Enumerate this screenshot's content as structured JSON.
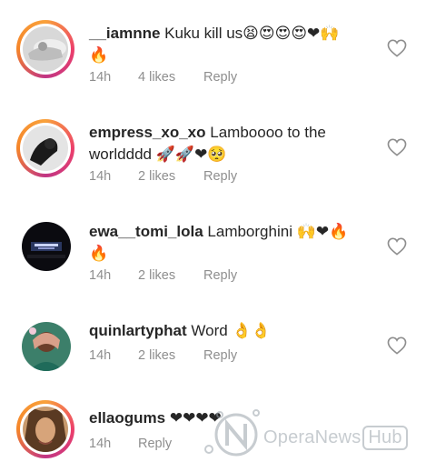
{
  "comments": [
    {
      "username": "__iamnne",
      "text": "Kuku kill us",
      "emojis_line1": "😫😍😍😍❤🙌",
      "emojis_line2": "🔥",
      "time": "14h",
      "likes": "4 likes",
      "reply": "Reply",
      "has_story_ring": true
    },
    {
      "username": "empress_xo_xo",
      "text_line1": "Lamboooo to the",
      "text_line2": "worldddd",
      "emojis": "🚀🚀❤🥺",
      "time": "14h",
      "likes": "2 likes",
      "reply": "Reply",
      "has_story_ring": true
    },
    {
      "username": "ewa__tomi_lola",
      "text": "Lamborghini",
      "emojis_line1": "🙌❤🔥",
      "emojis_line2": "🔥",
      "time": "14h",
      "likes": "2 likes",
      "reply": "Reply",
      "has_story_ring": false
    },
    {
      "username": "quinlartyphat",
      "text": "Word",
      "emojis": "👌👌",
      "time": "14h",
      "likes": "2 likes",
      "reply": "Reply",
      "has_story_ring": false
    },
    {
      "username": "ellaogums",
      "emojis": "❤❤❤❤",
      "time": "14h",
      "reply": "Reply",
      "has_story_ring": true
    }
  ],
  "watermark": {
    "brand": "OperaNews",
    "hub": "Hub"
  },
  "colors": {
    "text": "#262626",
    "meta": "#8e8e8e",
    "heart_outline": "#8e8e8e"
  },
  "icons": {
    "like": "heart-outline-icon"
  }
}
